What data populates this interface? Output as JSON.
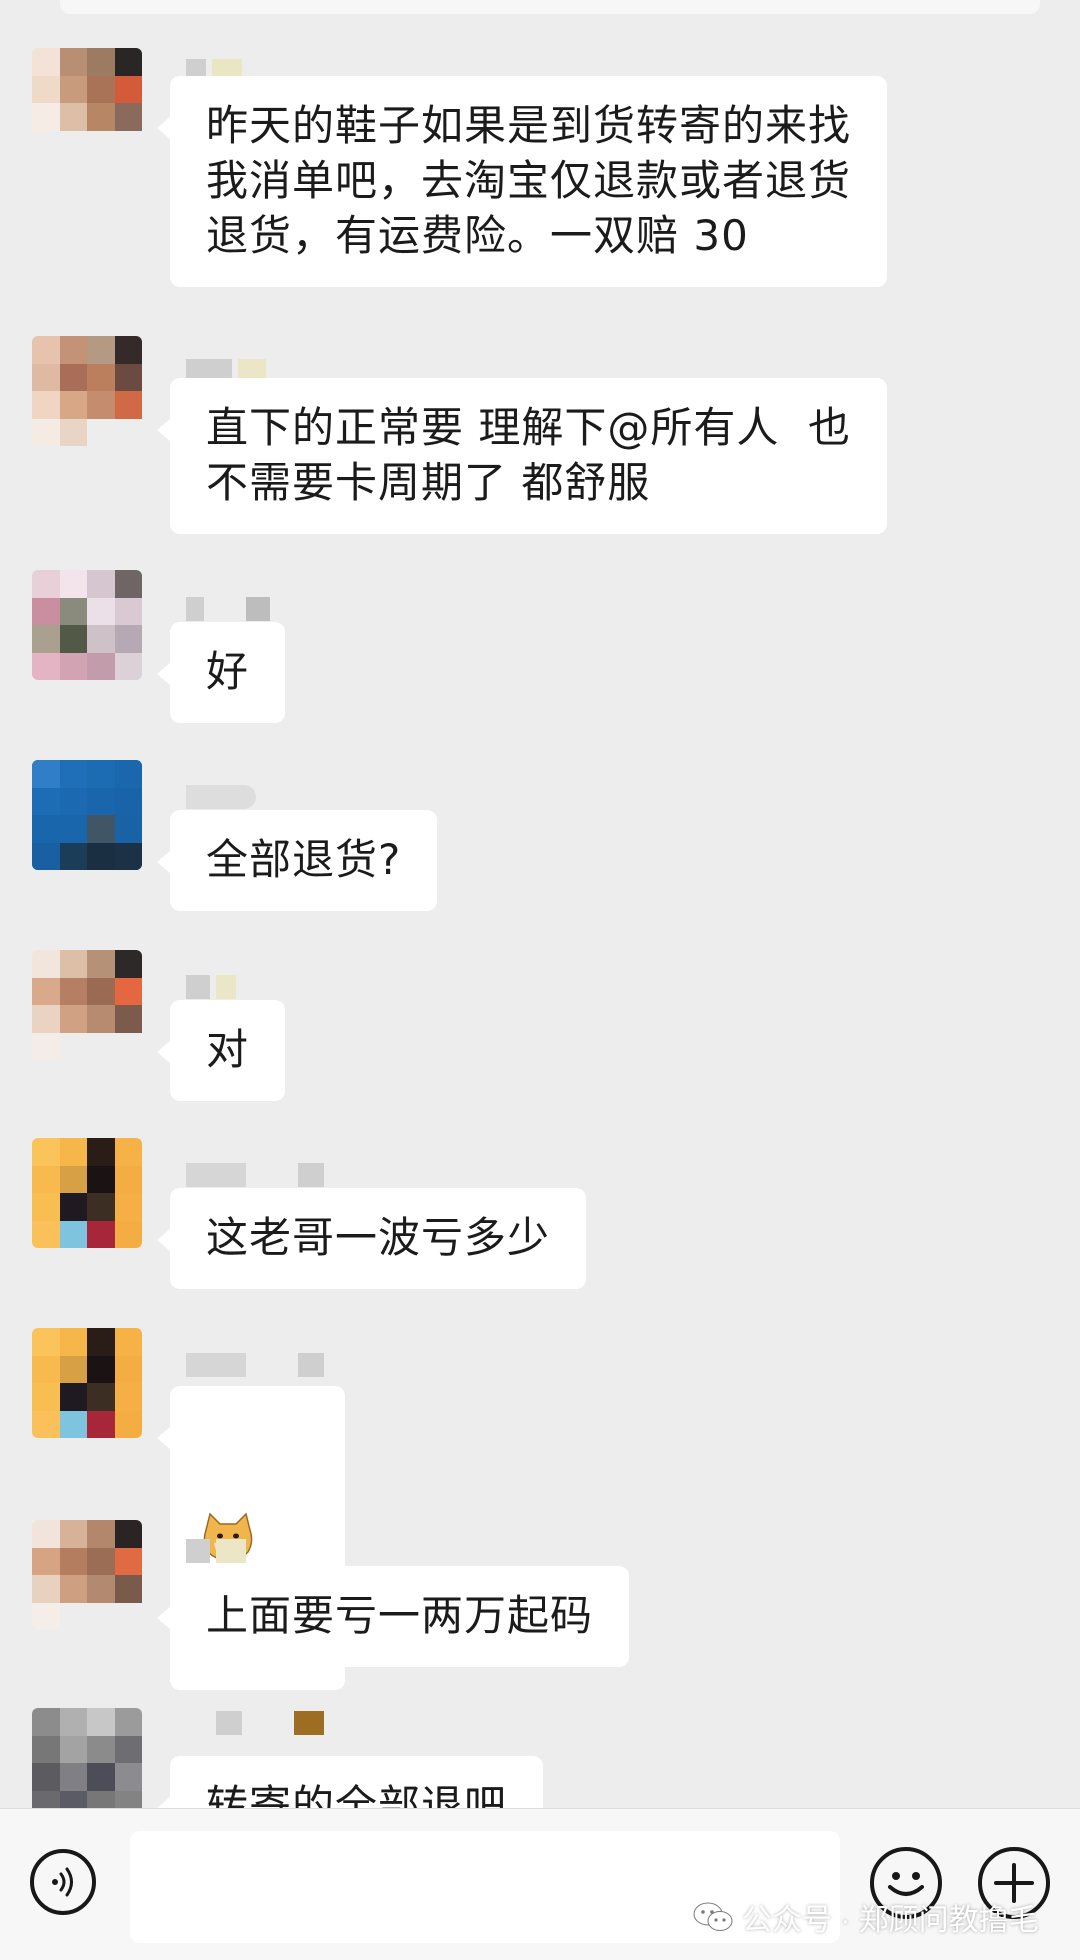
{
  "messages": [
    {
      "id": "m1",
      "text": "昨天的鞋子如果是到货转寄的来找\n我消单吧，去淘宝仅退款或者退货\n退货，有运费险。一双赔 30"
    },
    {
      "id": "m2",
      "text": "直下的正常要 理解下@所有人  也\n不需要卡周期了 都舒服"
    },
    {
      "id": "m3",
      "text": "好"
    },
    {
      "id": "m4",
      "text": "全部退货?"
    },
    {
      "id": "m5",
      "text": "对"
    },
    {
      "id": "m6",
      "text": "这老哥一波亏多少"
    },
    {
      "id": "m7",
      "text": "",
      "sticker": "doge-emoji"
    },
    {
      "id": "m8",
      "text": "上面要亏一两万起码"
    },
    {
      "id": "m9",
      "text": "转寄的全部退吧"
    }
  ],
  "input_bar": {
    "message_value": "",
    "voice_icon": "voice-icon",
    "emoji_icon": "smiley-icon",
    "plus_icon": "plus-icon"
  },
  "watermark": {
    "text": "公众号 · 郑顾问教撸毛",
    "icon": "wechat-icon"
  },
  "colors": {
    "background": "#ededed",
    "bubble": "#ffffff",
    "text": "#1b1b1b",
    "input_bar": "#f7f7f7"
  }
}
